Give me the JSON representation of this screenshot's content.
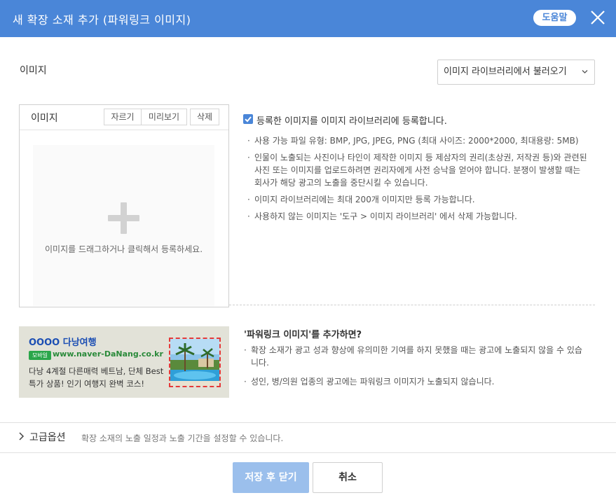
{
  "header": {
    "title": "새 확장 소재 추가 (파워링크 이미지)",
    "help_label": "도움말"
  },
  "section": {
    "label": "이미지",
    "library_select": "이미지 라이브러리에서 불러오기"
  },
  "image_box": {
    "title": "이미지",
    "crop_label": "자르기",
    "preview_label": "미리보기",
    "delete_label": "삭제",
    "drop_text": "이미지를 드래그하거나 클릭해서 등록하세요."
  },
  "register": {
    "checked": true,
    "label": "등록한 이미지를 이미지 라이브러리에 등록합니다."
  },
  "info": [
    "사용 가능 파일 유형: BMP, JPG, JPEG, PNG (최대 사이즈: 2000*2000, 최대용량: 5MB)",
    "인물이 노출되는 사진이나 타인이 제작한 이미지 등 제삼자의 권리(초상권, 저작권 등)와 관련된 사진 또는 이미지를 업로드하려면 권리자에게 사전 승낙을 얻어야 합니다. 분쟁이 발생할 때는 회사가 해당 광고의 노출을 중단시킬 수 있습니다.",
    "이미지 라이브러리에는 최대 200개 이미지만 등록 가능합니다.",
    "사용하지 않는 이미지는 '도구 > 이미지 라이브러리' 에서 삭제 가능합니다."
  ],
  "ad_preview": {
    "title": "OOOO 다낭여행",
    "mobile_badge": "모바일",
    "url": "www.naver-DaNang.co.kr",
    "desc": "다낭 4계절 다른매력 베트남, 단체 Best 특가 상품! 인기 여행지 완벽 코스!"
  },
  "powerlink": {
    "title": "'파워링크 이미지'를 추가하면?",
    "items": [
      "확장 소재가 광고 성과 향상에 유의미한 기여를 하지 못했을 때는 광고에 노출되지 않을 수 있습니다.",
      "성인, 병/의원 업종의 광고에는 파워링크 이미지가 노출되지 않습니다."
    ]
  },
  "advanced": {
    "title": "고급옵션",
    "desc": "확장 소재의 노출 일정과 노출 기간을 설정할 수 있습니다."
  },
  "footer": {
    "save_label": "저장 후 닫기",
    "cancel_label": "취소"
  },
  "colors": {
    "header_bg": "#4a86d8",
    "save_bg": "#9bbfec"
  }
}
